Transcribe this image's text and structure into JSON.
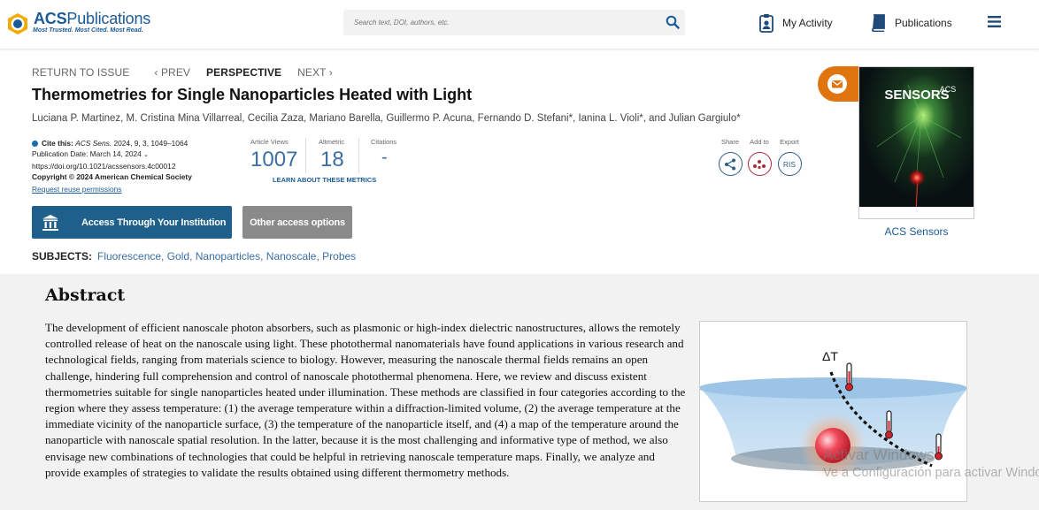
{
  "header": {
    "brand": "ACS",
    "brand_suffix": "Publications",
    "tagline": "Most Trusted. Most Cited. Most Read.",
    "search_placeholder": "Search text, DOI, authors, etc.",
    "my_activity": "My Activity",
    "publications": "Publications"
  },
  "article_nav": {
    "return": "RETURN TO ISSUE",
    "prev": "‹ PREV",
    "current": "PERSPECTIVE",
    "next": "NEXT ›"
  },
  "article": {
    "title": "Thermometries for Single Nanoparticles Heated with Light",
    "authors": "Luciana P. Martinez, M. Cristina Mina Villarreal, Cecilia Zaza, Mariano Barella, Guillermo P. Acuna, Fernando D. Stefani*, Ianina L. Violi*, and Julian Gargiulo*",
    "cite_label": "Cite this:",
    "cite_journal": "ACS Sens.",
    "cite_ref": "2024, 9, 3, 1049–1064",
    "pub_date": "Publication Date: March 14, 2024",
    "doi": "https://doi.org/10.1021/acssensors.4c00012",
    "copyright": "Copyright © 2024 American Chemical Society",
    "permissions": "Request reuse permissions"
  },
  "metrics": {
    "views_label": "Article Views",
    "views": "1007",
    "altmetric_label": "Altmetric",
    "altmetric": "18",
    "citations_label": "Citations",
    "citations": "-",
    "learn": "LEARN ABOUT THESE METRICS"
  },
  "tools": {
    "share": "Share",
    "add_to": "Add to",
    "export": "Export",
    "ris": "RIS"
  },
  "buttons": {
    "access": "Access Through Your Institution",
    "other": "Other access options"
  },
  "subjects": {
    "label": "SUBJECTS:",
    "tags": "Fluorescence, Gold, Nanoparticles, Nanoscale, Probes"
  },
  "journal": {
    "cover_title": "SENSORS",
    "cover_acs": "ACS",
    "name": "ACS Sensors"
  },
  "abstract": {
    "heading": "Abstract",
    "text": "The development of efficient nanoscale photon absorbers, such as plasmonic or high-index dielectric nanostructures, allows the remotely controlled release of heat on the nanoscale using light. These photothermal nanomaterials have found applications in various research and technological fields, ranging from materials science to biology. However, measuring the nanoscale thermal fields remains an open challenge, hindering full comprehension and control of nanoscale photothermal phenomena. Here, we review and discuss existent thermometries suitable for single nanoparticles heated under illumination. These methods are classified in four categories according to the region where they assess temperature: (1) the average temperature within a diffraction-limited volume, (2) the average temperature at the immediate vicinity of the nanoparticle surface, (3) the temperature of the nanoparticle itself, and (4) a map of the temperature around the nanoparticle with nanoscale spatial resolution. In the latter, because it is the most challenging and informative type of method, we also envisage new combinations of technologies that could be helpful in retrieving nanoscale temperature maps. Finally, we analyze and provide examples of strategies to validate the results obtained using different thermometry methods.",
    "graphic_label": "ΔT"
  },
  "watermark": {
    "line1": "Activar Windows",
    "line2": "Ve a Configuración para activar Windows."
  }
}
